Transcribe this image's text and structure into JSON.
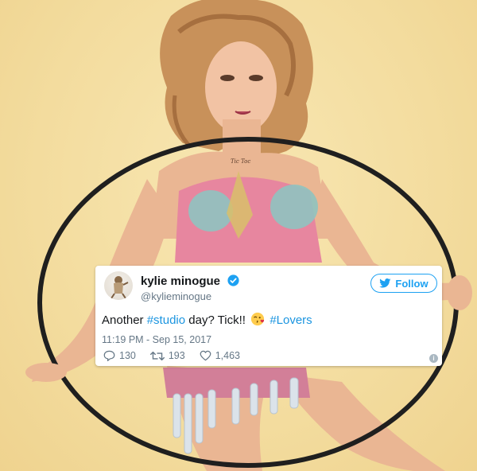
{
  "photo": {
    "tattoo_text": "Tic Toc"
  },
  "tweet": {
    "display_name": "kylie minogue",
    "handle": "@kylieminogue",
    "follow_label": "Follow",
    "text_prefix": "Another ",
    "hashtag_studio": "#studio",
    "text_middle": " day? Tick!! ",
    "emoji": "face-blowing-kiss",
    "hashtag_lovers": "#Lovers",
    "timestamp": "11:19 PM - Sep 15, 2017",
    "replies": "130",
    "retweets": "193",
    "likes": "1,463",
    "info_glyph": "i"
  },
  "colors": {
    "twitter_blue": "#1da1f2",
    "link": "#1b95e0",
    "muted": "#657786",
    "background": "#f3dc9e"
  },
  "icons": [
    "twitter-bird-icon",
    "verified-badge-icon",
    "reply-icon",
    "retweet-icon",
    "heart-icon",
    "info-icon"
  ]
}
